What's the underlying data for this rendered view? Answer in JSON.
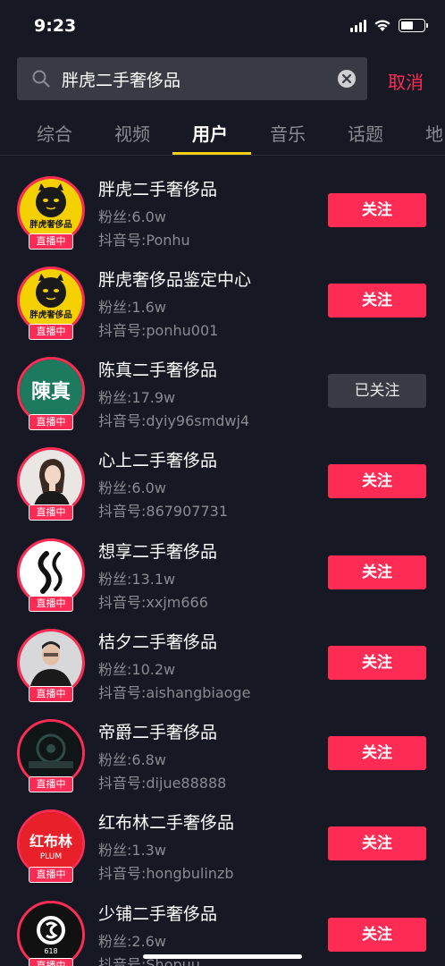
{
  "status_bar": {
    "time": "9:23"
  },
  "search": {
    "query": "胖虎二手奢侈品",
    "cancel_label": "取消"
  },
  "tabs": [
    {
      "label": "综合"
    },
    {
      "label": "视频"
    },
    {
      "label": "用户"
    },
    {
      "label": "音乐"
    },
    {
      "label": "话题"
    },
    {
      "label": "地"
    }
  ],
  "active_tab": "用户",
  "live_label": "直播中",
  "users": [
    {
      "name": "胖虎二手奢侈品",
      "fans": "粉丝:6.0w",
      "id": "抖音号:Ponhu",
      "button": "关注",
      "followed": false,
      "avatar": "panghu",
      "avatar_text": "胖虎奢侈品"
    },
    {
      "name": "胖虎奢侈品鉴定中心",
      "fans": "粉丝:1.6w",
      "id": "抖音号:ponhu001",
      "button": "关注",
      "followed": false,
      "avatar": "panghu",
      "avatar_text": "胖虎奢侈品"
    },
    {
      "name": "陈真二手奢侈品",
      "fans": "粉丝:17.9w",
      "id": "抖音号:dyiy96smdwj4",
      "button": "已关注",
      "followed": true,
      "avatar": "chenzhen",
      "avatar_text": "陳真"
    },
    {
      "name": "心上二手奢侈品",
      "fans": "粉丝:6.0w",
      "id": "抖音号:867907731",
      "button": "关注",
      "followed": false,
      "avatar": "woman",
      "avatar_text": ""
    },
    {
      "name": "想享二手奢侈品",
      "fans": "粉丝:13.1w",
      "id": "抖音号:xxjm666",
      "button": "关注",
      "followed": false,
      "avatar": "logo-s",
      "avatar_text": ""
    },
    {
      "name": "桔夕二手奢侈品",
      "fans": "粉丝:10.2w",
      "id": "抖音号:aishangbiaoge",
      "button": "关注",
      "followed": false,
      "avatar": "man",
      "avatar_text": ""
    },
    {
      "name": "帝爵二手奢侈品",
      "fans": "粉丝:6.8w",
      "id": "抖音号:dijue88888",
      "button": "关注",
      "followed": false,
      "avatar": "dark-logo",
      "avatar_text": ""
    },
    {
      "name": "红布林二手奢侈品",
      "fans": "粉丝:1.3w",
      "id": "抖音号:hongbulinzb",
      "button": "关注",
      "followed": false,
      "avatar": "plum",
      "avatar_text": "红布林",
      "avatar_subtext": "PLUM"
    },
    {
      "name": "少铺二手奢侈品",
      "fans": "粉丝:2.6w",
      "id": "抖音号:Shopuu",
      "button": "关注",
      "followed": false,
      "avatar": "shaopu",
      "avatar_text": "618"
    }
  ],
  "colors": {
    "background": "#161823",
    "accent": "#fe2c55",
    "tab_indicator": "#face15",
    "muted_text": "#8a8b91"
  }
}
